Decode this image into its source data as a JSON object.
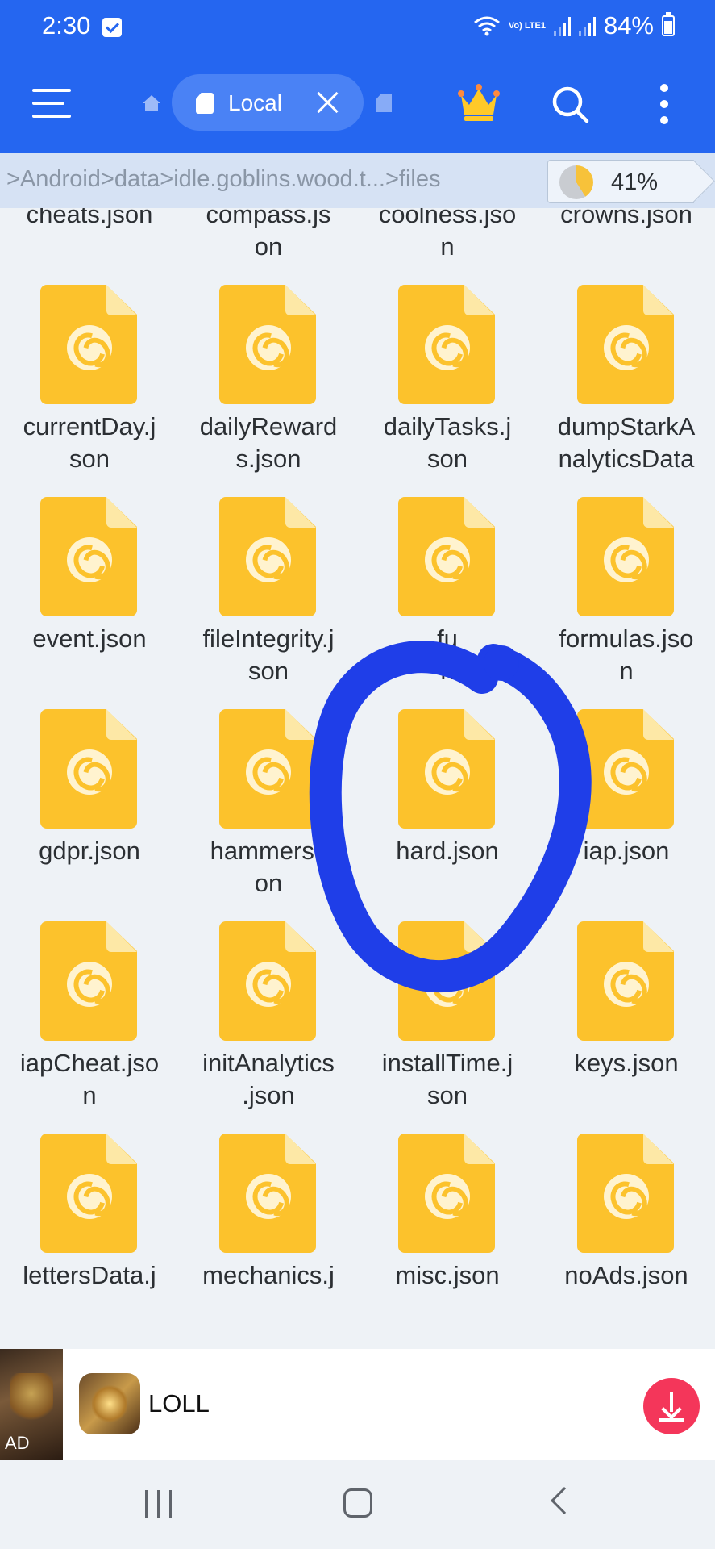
{
  "status_bar": {
    "time": "2:30",
    "network_label": "Vo) LTE1",
    "battery": "84%"
  },
  "app_bar": {
    "tab_label": "Local"
  },
  "path_bar": {
    "breadcrumb": ">Android>data>idle.goblins.wood.t...>files",
    "storage_percent": "41%",
    "storage_used_fraction": 0.41
  },
  "files": [
    {
      "name": "cheats.json"
    },
    {
      "name": "compass.json"
    },
    {
      "name": "coolness.json"
    },
    {
      "name": "crowns.json"
    },
    {
      "name": "currentDay.json"
    },
    {
      "name": "dailyRewards.json"
    },
    {
      "name": "dailyTasks.json"
    },
    {
      "name": "dumpStarkAnalyticsData"
    },
    {
      "name": "event.json"
    },
    {
      "name": "fileIntegrity.json"
    },
    {
      "name": "fu"
    },
    {
      "name": "formulas.json"
    },
    {
      "name": "gdpr.json"
    },
    {
      "name": "hammers.json"
    },
    {
      "name": "hard.json"
    },
    {
      "name": "iap.json"
    },
    {
      "name": "iapCheat.json"
    },
    {
      "name": "initAnalytics.json"
    },
    {
      "name": "installTime.json"
    },
    {
      "name": "keys.json"
    },
    {
      "name": "lettersData.j"
    },
    {
      "name": "mechanics.j"
    },
    {
      "name": "misc.json"
    },
    {
      "name": "noAds.json"
    }
  ],
  "ad": {
    "tag": "AD",
    "title": "LOLL"
  },
  "colors": {
    "accent": "#2566f0",
    "file_icon": "#fcc22c",
    "annotation": "#1f3ee8",
    "download_button": "#f4365a"
  }
}
